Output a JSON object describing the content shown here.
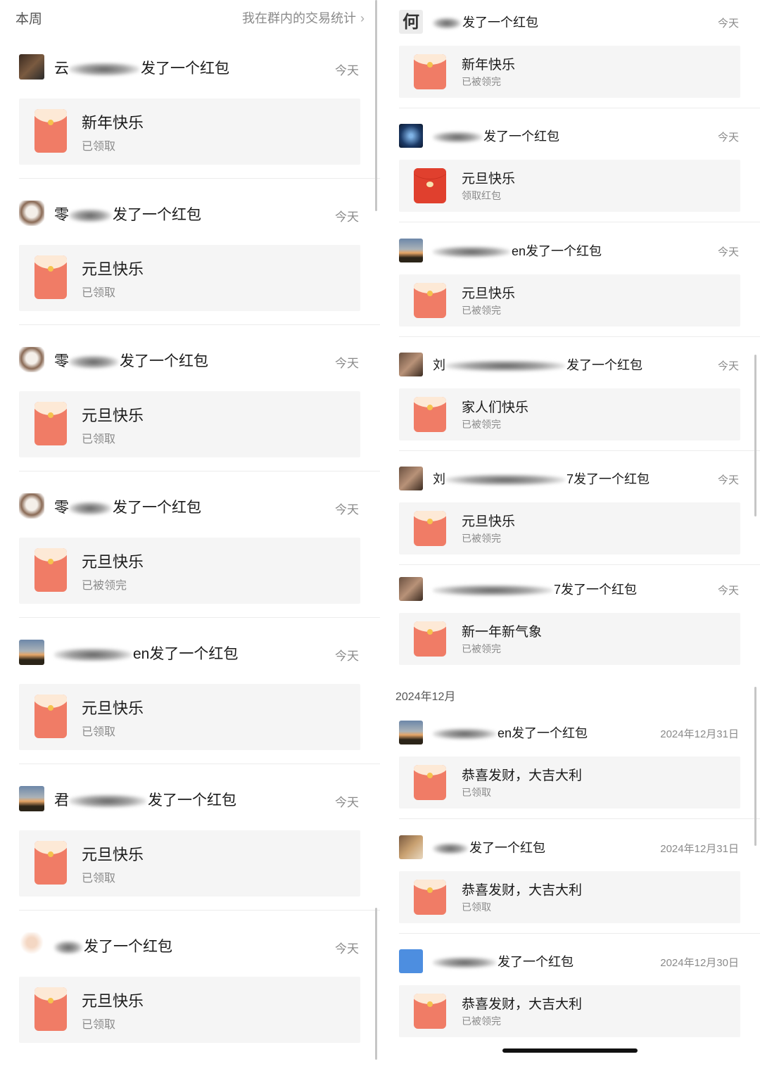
{
  "left": {
    "section_title": "本周",
    "stats_link": "我在群内的交易统计",
    "stats_chevron": "›",
    "items": [
      {
        "sender_pre": "云",
        "sender_post": "发了一个红包",
        "date": "今天",
        "title": "新年快乐",
        "status": "已领取",
        "avatar": "av-red"
      },
      {
        "sender_pre": "零",
        "sender_post": "发了一个红包",
        "date": "今天",
        "title": "元旦快乐",
        "status": "已领取",
        "avatar": "av-cat"
      },
      {
        "sender_pre": "零",
        "sender_post": "发了一个红包",
        "date": "今天",
        "title": "元旦快乐",
        "status": "已领取",
        "avatar": "av-cat"
      },
      {
        "sender_pre": "零",
        "sender_post": "发了一个红包",
        "date": "今天",
        "title": "元旦快乐",
        "status": "已被领完",
        "avatar": "av-cat"
      },
      {
        "sender_pre": "",
        "sender_post": "en发了一个红包",
        "date": "今天",
        "title": "元旦快乐",
        "status": "已领取",
        "avatar": "av-sunset"
      },
      {
        "sender_pre": "君",
        "sender_post": "发了一个红包",
        "date": "今天",
        "title": "元旦快乐",
        "status": "已领取",
        "avatar": "av-sunset"
      },
      {
        "sender_pre": "",
        "sender_post": "发了一个红包",
        "date": "今天",
        "title": "元旦快乐",
        "status": "已领取",
        "avatar": "av-girl"
      }
    ]
  },
  "right": {
    "month_header": "2024年12月",
    "items": [
      {
        "sender_pre": "",
        "sender_post": "发了一个红包",
        "date": "今天",
        "title": "新年快乐",
        "status": "已被领完",
        "avatar": "av-he",
        "avatar_text": "何",
        "env": "light"
      },
      {
        "sender_pre": "",
        "sender_post": "发了一个红包",
        "date": "今天",
        "title": "元旦快乐",
        "status": "领取红包",
        "avatar": "av-robot",
        "env": "dark"
      },
      {
        "sender_pre": "",
        "sender_post": "en发了一个红包",
        "date": "今天",
        "title": "元旦快乐",
        "status": "已被领完",
        "avatar": "av-sunset",
        "env": "light"
      },
      {
        "sender_pre": "刘",
        "sender_post": "发了一个红包",
        "date": "今天",
        "title": "家人们快乐",
        "status": "已被领完",
        "avatar": "av-brown",
        "env": "light"
      },
      {
        "sender_pre": "刘",
        "sender_post": "7发了一个红包",
        "date": "今天",
        "title": "元旦快乐",
        "status": "已被领完",
        "avatar": "av-brown",
        "env": "light"
      },
      {
        "sender_pre": "",
        "sender_post": "7发了一个红包",
        "date": "今天",
        "title": "新一年新气象",
        "status": "已被领完",
        "avatar": "av-brown",
        "env": "light"
      },
      {
        "sender_pre": "",
        "sender_post": "en发了一个红包",
        "date": "2024年12月31日",
        "title": "恭喜发财，大吉大利",
        "status": "已领取",
        "avatar": "av-sunset",
        "env": "light"
      },
      {
        "sender_pre": "",
        "sender_post": "发了一个红包",
        "date": "2024年12月31日",
        "title": "恭喜发财，大吉大利",
        "status": "已领取",
        "avatar": "av-dog",
        "env": "light"
      },
      {
        "sender_pre": "",
        "sender_post": "发了一个红包",
        "date": "2024年12月30日",
        "title": "恭喜发财，大吉大利",
        "status": "已被领完",
        "avatar": "av-blue",
        "env": "light"
      }
    ]
  }
}
